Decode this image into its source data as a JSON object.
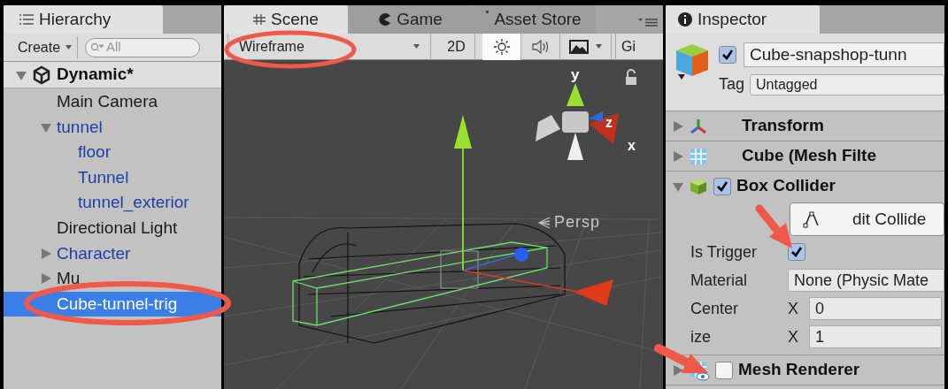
{
  "hierarchy": {
    "tab": "Hierarchy",
    "create": "Create",
    "search_placeholder": "All",
    "scene": {
      "name": "Dynamic*",
      "expanded": true
    },
    "items": [
      {
        "name": "Main Camera",
        "kind": "object",
        "selected": false
      },
      {
        "name": "tunnel",
        "kind": "prefab",
        "selected": false,
        "expanded": true,
        "children": [
          {
            "name": "floor",
            "kind": "prefab",
            "selected": false
          },
          {
            "name": "Tunnel",
            "kind": "prefab",
            "selected": false
          },
          {
            "name": "tunnel_exterior",
            "kind": "prefab",
            "selected": false
          }
        ]
      },
      {
        "name": "Directional Light",
        "kind": "object",
        "selected": false
      },
      {
        "name": "Character",
        "kind": "prefab",
        "selected": false,
        "expanded": false
      },
      {
        "name": "Mu",
        "kind": "object",
        "selected": false,
        "expanded": false
      },
      {
        "name": "Cube-tunnel-trig",
        "selected": true
      }
    ]
  },
  "scene_view": {
    "tabs": [
      {
        "label": "Scene",
        "selected": true
      },
      {
        "label": "Game",
        "selected": false
      },
      {
        "label": "Asset Store",
        "selected": false
      }
    ],
    "draw_mode": "Wireframe",
    "two_d": "2D",
    "lighting_on": true,
    "audio_on": false,
    "gizmos": "Gi",
    "projection": "Persp",
    "axes": [
      "y",
      "z",
      "x"
    ]
  },
  "inspector": {
    "tab": "Inspector",
    "active": true,
    "name": "Cube-snapshop-tunn",
    "tag_label": "Tag",
    "tag": "Untagged",
    "components": [
      {
        "name": "Transform",
        "expanded": false
      },
      {
        "name": "Cube (Mesh Filte",
        "expanded": false
      },
      {
        "name": "Box Collider",
        "expanded": true,
        "enabled": true,
        "edit_button": "dit Collide",
        "fields": [
          {
            "kind": "checkbox",
            "label": "Is Trigger",
            "checked": true
          },
          {
            "kind": "object",
            "label": "Material",
            "value": "None (Physic Mate"
          },
          {
            "kind": "vector",
            "label": "Center",
            "axis": "X",
            "value": "0"
          },
          {
            "kind": "vector",
            "label": "ize",
            "axis": "X",
            "value": "1"
          }
        ]
      },
      {
        "name": "Mesh Renderer",
        "expanded": false,
        "enabled": false
      }
    ]
  }
}
